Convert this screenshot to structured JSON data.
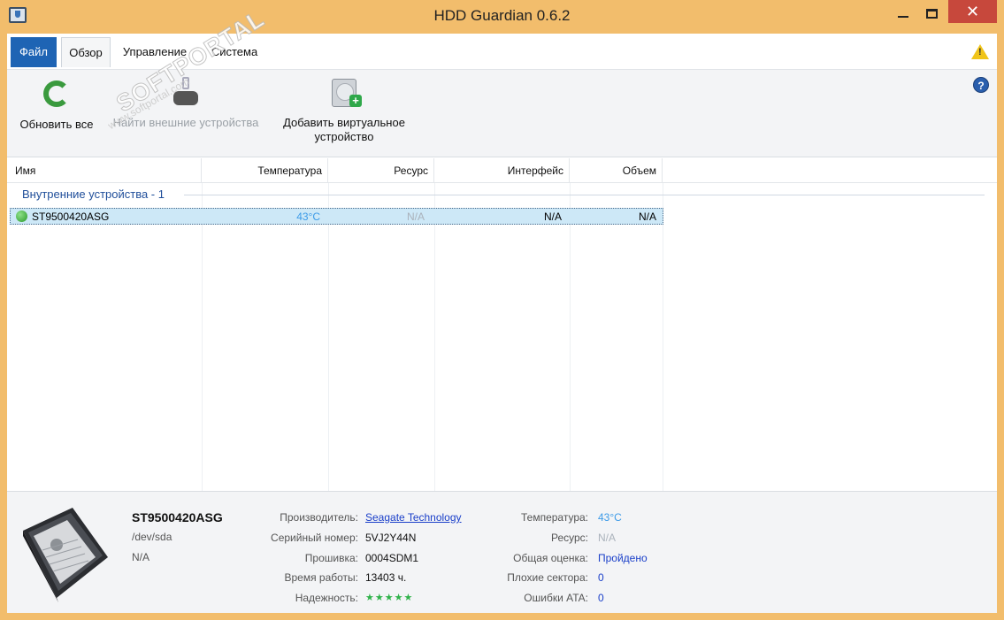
{
  "window": {
    "title": "HDD Guardian 0.6.2"
  },
  "menu": {
    "items": [
      "Файл",
      "Обзор",
      "Управление",
      "Система"
    ]
  },
  "toolbar": {
    "refresh_all": "Обновить все",
    "find_external": "Найти внешние устройства",
    "add_virtual_line1": "Добавить виртуальное",
    "add_virtual_line2": "устройство"
  },
  "grid": {
    "columns": [
      "Имя",
      "Температура",
      "Ресурс",
      "Интерфейс",
      "Объем"
    ],
    "group_label": "Внутренние устройства - 1",
    "rows": [
      {
        "name": "ST9500420ASG",
        "temperature": "43°C",
        "resource": "N/A",
        "interface": "N/A",
        "volume": "N/A",
        "status_color": "#2a9a2a"
      }
    ]
  },
  "details": {
    "model": "ST9500420ASG",
    "path": "/dev/sda",
    "extra": "N/A",
    "fields_left": [
      {
        "label": "Производитель:",
        "value": "Seagate Technology"
      },
      {
        "label": "Серийный номер:",
        "value": "5VJ2Y44N"
      },
      {
        "label": "Прошивка:",
        "value": "0004SDM1"
      },
      {
        "label": "Время работы:",
        "value": "13403 ч."
      },
      {
        "label": "Надежность:",
        "value": "★★★★★",
        "rating": 5,
        "max_rating": 5
      }
    ],
    "fields_right": [
      {
        "label": "Температура:",
        "value": "43°C"
      },
      {
        "label": "Ресурс:",
        "value": "N/A"
      },
      {
        "label": "Общая оценка:",
        "value": "Пройдено"
      },
      {
        "label": "Плохие сектора:",
        "value": "0"
      },
      {
        "label": "Ошибки ATA:",
        "value": "0"
      }
    ]
  },
  "watermark": {
    "text": "SOFTPORTAL",
    "sub": "www.softportal.com"
  },
  "colors": {
    "title_bar": "#f2bd6c",
    "accent": "#1e64b4",
    "selection": "#cde8f7",
    "close_button": "#c7483c",
    "temperature": "#3d9be8",
    "status_ok": "#2fb24a"
  }
}
